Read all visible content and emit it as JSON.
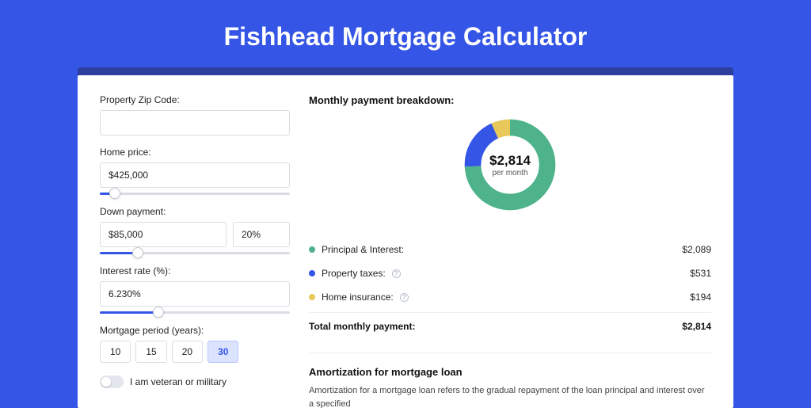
{
  "title": "Fishhead Mortgage Calculator",
  "form": {
    "zip_label": "Property Zip Code:",
    "zip_value": "",
    "home_price_label": "Home price:",
    "home_price_value": "$425,000",
    "home_price_slider_pct": 8,
    "down_payment_label": "Down payment:",
    "down_payment_value": "$85,000",
    "down_payment_pct_value": "20%",
    "down_payment_slider_pct": 20,
    "interest_label": "Interest rate (%):",
    "interest_value": "6.230%",
    "interest_slider_pct": 31,
    "period_label": "Mortgage period (years):",
    "periods": [
      "10",
      "15",
      "20",
      "30"
    ],
    "period_selected": "30",
    "veteran_label": "I am veteran or military"
  },
  "breakdown": {
    "title": "Monthly payment breakdown:",
    "center_amount": "$2,814",
    "center_label": "per month",
    "items": [
      {
        "label": "Principal & Interest:",
        "value": "$2,089",
        "color": "g",
        "has_info": false
      },
      {
        "label": "Property taxes:",
        "value": "$531",
        "color": "b",
        "has_info": true
      },
      {
        "label": "Home insurance:",
        "value": "$194",
        "color": "y",
        "has_info": true
      }
    ],
    "total_label": "Total monthly payment:",
    "total_value": "$2,814"
  },
  "amortization": {
    "title": "Amortization for mortgage loan",
    "text": "Amortization for a mortgage loan refers to the gradual repayment of the loan principal and interest over a specified"
  },
  "chart_data": {
    "type": "pie",
    "title": "Monthly payment breakdown",
    "total": 2814,
    "unit": "USD per month",
    "series": [
      {
        "name": "Principal & Interest",
        "value": 2089,
        "color": "#4eb38b"
      },
      {
        "name": "Property taxes",
        "value": 531,
        "color": "#3555e6"
      },
      {
        "name": "Home insurance",
        "value": 194,
        "color": "#e9c85a"
      }
    ]
  }
}
